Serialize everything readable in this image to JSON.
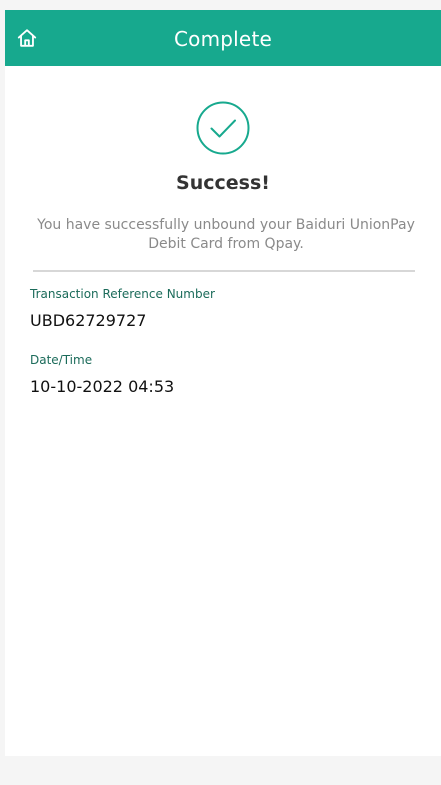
{
  "header": {
    "title": "Complete",
    "home_icon": "home-icon"
  },
  "result": {
    "icon": "check-circle-icon",
    "title": "Success!",
    "message": "You have successfully unbound your Baiduri UnionPay Debit Card from Qpay."
  },
  "details": {
    "reference_label": "Transaction Reference Number",
    "reference_value": "UBD62729727",
    "datetime_label": "Date/Time",
    "datetime_value": "10-10-2022 04:53"
  },
  "colors": {
    "header_bg": "#17a98e",
    "accent": "#17a98e",
    "label_text": "#1b6b5a"
  }
}
